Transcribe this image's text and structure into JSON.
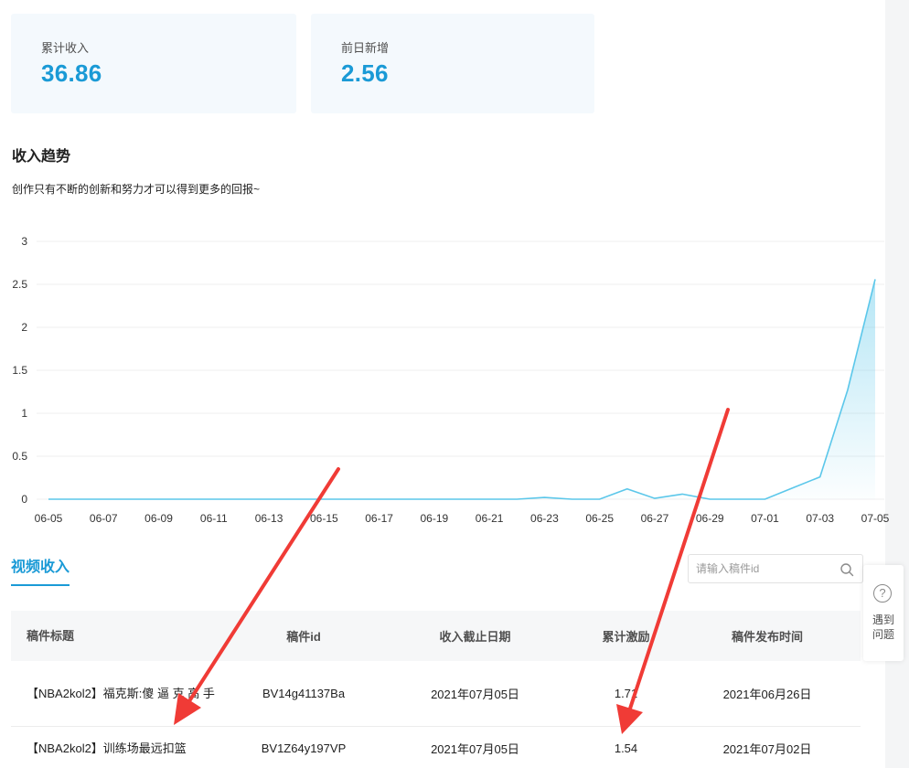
{
  "summary": {
    "total_income_label": "累计收入",
    "total_income_value": "36.86",
    "yesterday_label": "前日新增",
    "yesterday_value": "2.56"
  },
  "trend": {
    "title": "收入趋势",
    "subtitle": "创作只有不断的创新和努力才可以得到更多的回报~"
  },
  "chart_data": {
    "type": "area",
    "x_tick_labels": [
      "06-05",
      "06-07",
      "06-09",
      "06-11",
      "06-13",
      "06-15",
      "06-17",
      "06-19",
      "06-21",
      "06-23",
      "06-25",
      "06-27",
      "06-29",
      "07-01",
      "07-03",
      "07-05"
    ],
    "ylim": [
      0,
      3
    ],
    "y_ticks": [
      "0",
      "0.5",
      "1",
      "1.5",
      "2",
      "2.5",
      "3"
    ],
    "grid": true,
    "line_color": "#5bc7ea",
    "series": [
      {
        "x": [
          "06-05",
          "06-06",
          "06-07",
          "06-08",
          "06-09",
          "06-10",
          "06-11",
          "06-12",
          "06-13",
          "06-14",
          "06-15",
          "06-16",
          "06-17",
          "06-18",
          "06-19",
          "06-20",
          "06-21",
          "06-22",
          "06-23",
          "06-24",
          "06-25",
          "06-26",
          "06-27",
          "06-28",
          "06-29",
          "06-30",
          "07-01",
          "07-02",
          "07-03",
          "07-04",
          "07-05"
        ],
        "y": [
          0,
          0,
          0,
          0,
          0,
          0,
          0,
          0,
          0,
          0,
          0,
          0,
          0,
          0,
          0,
          0,
          0,
          0,
          0.02,
          0,
          0,
          0.12,
          0.01,
          0.06,
          0,
          0,
          0,
          0.13,
          0.26,
          1.27,
          2.56
        ]
      }
    ]
  },
  "tabs": {
    "video_income": "视频收入"
  },
  "search": {
    "placeholder": "请输入稿件id",
    "icon": "search-icon"
  },
  "table": {
    "headers": [
      "稿件标题",
      "稿件id",
      "收入截止日期",
      "累计激励",
      "稿件发布时间"
    ],
    "rows": [
      {
        "title": "【NBA2kol2】福克斯:傻 逼 克 高 手",
        "id": "BV14g41137Ba",
        "deadline": "2021年07月05日",
        "incentive": "1.71",
        "published": "2021年06月26日"
      },
      {
        "title": "【NBA2kol2】训练场最远扣篮",
        "id": "BV1Z64y197VP",
        "deadline": "2021年07月05日",
        "incentive": "1.54",
        "published": "2021年07月02日"
      }
    ]
  },
  "help": {
    "icon": "question-circle-icon",
    "label": "遇到问题"
  },
  "colors": {
    "accent": "#1a9ad6",
    "annotation_arrow": "#f03b36"
  }
}
